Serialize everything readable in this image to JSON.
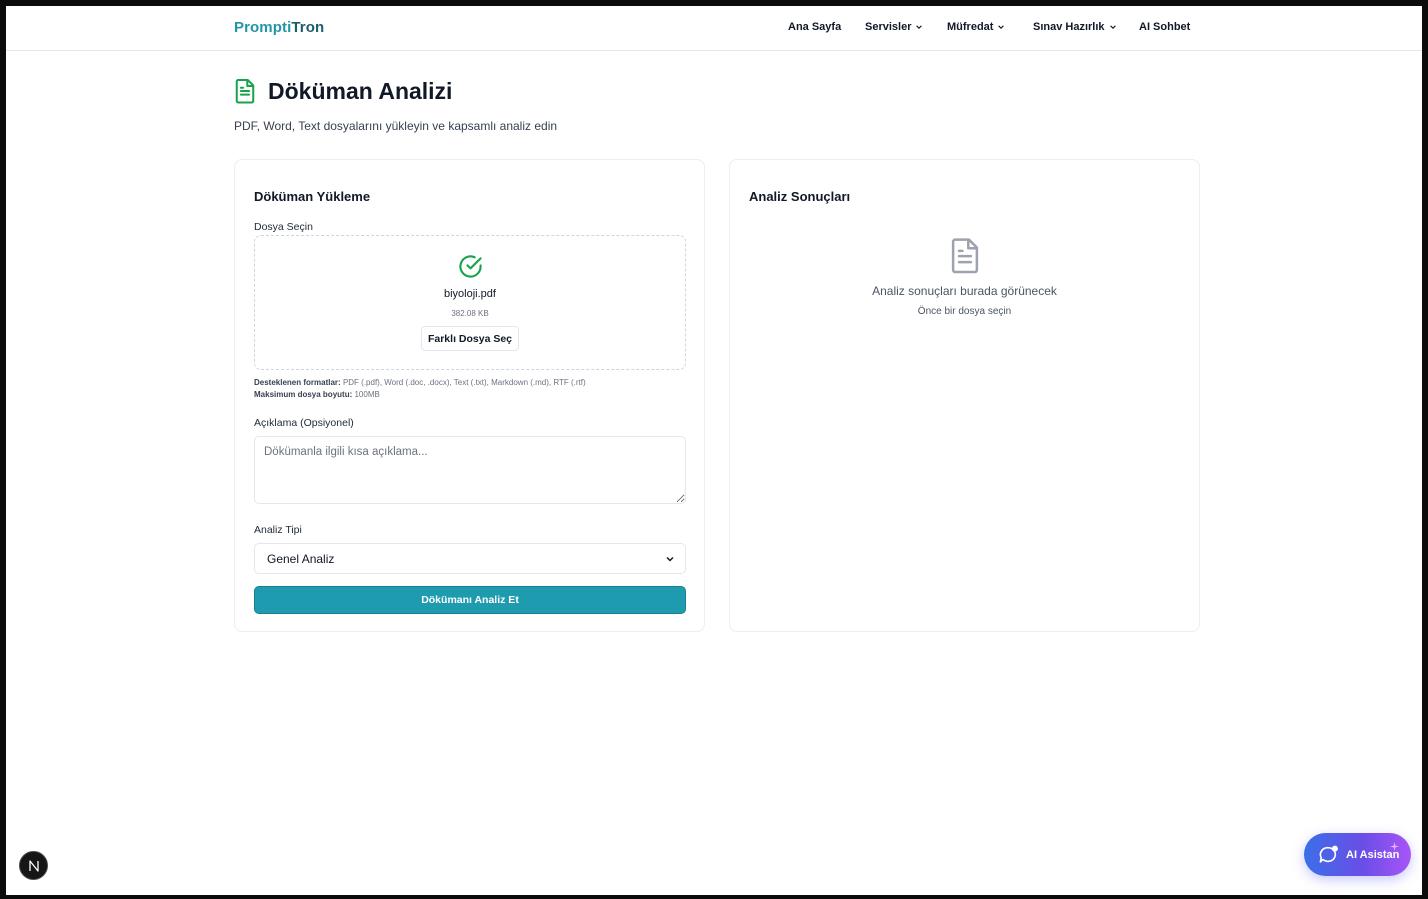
{
  "header": {
    "brand_part1": "Prompti",
    "brand_part2": "Tron",
    "nav": [
      {
        "label": "Ana Sayfa",
        "dropdown": false
      },
      {
        "label": "Servisler",
        "dropdown": true
      },
      {
        "label": "Müfredat",
        "dropdown": true
      },
      {
        "label": "Sınav Hazırlık",
        "dropdown": true
      },
      {
        "label": "AI Sohbet",
        "dropdown": false
      }
    ]
  },
  "page": {
    "title": "Döküman Analizi",
    "subtitle": "PDF, Word, Text dosyalarını yükleyin ve kapsamlı analiz edin",
    "title_icon": "document-icon",
    "accent_green": "#16a34a"
  },
  "upload_card": {
    "title": "Döküman Yükleme",
    "file_label": "Dosya Seçin",
    "file_name": "biyoloji.pdf",
    "file_size": "382.08 KB",
    "change_button": "Farklı Dosya Seç",
    "formats_label": "Desteklenen formatlar:",
    "formats_value": "PDF (.pdf), Word (.doc, .docx), Text (.txt), Markdown (.md), RTF (.rtf)",
    "maxsize_label": "Maksimum dosya boyutu:",
    "maxsize_value": "100MB",
    "description_label": "Açıklama (Opsiyonel)",
    "description_placeholder": "Dökümanla ilgili kısa açıklama...",
    "description_value": "",
    "analysis_type_label": "Analiz Tipi",
    "analysis_type_selected": "Genel Analiz",
    "submit_button": "Dökümanı Analiz Et",
    "submit_color": "#1f9bb0"
  },
  "results_card": {
    "title": "Analiz Sonuçları",
    "empty_title": "Analiz sonuçları burada görünecek",
    "empty_hint": "Önce bir dosya seçin"
  },
  "floating": {
    "next_badge": "N",
    "ai_button": "AI Asistan"
  }
}
